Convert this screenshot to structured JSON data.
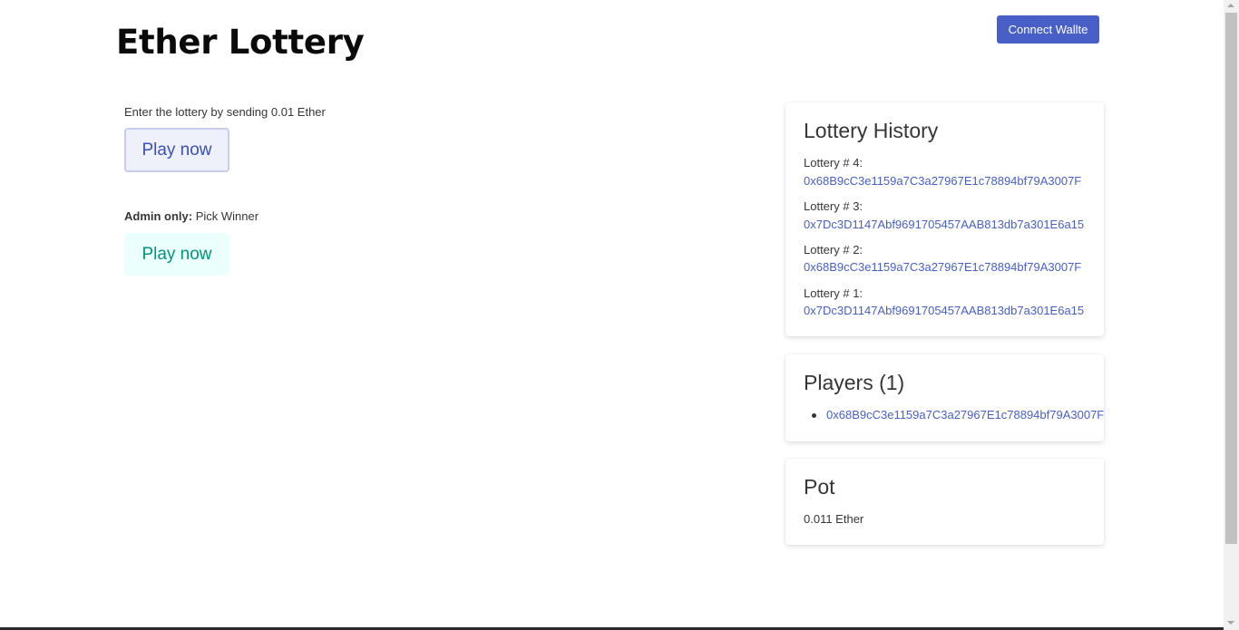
{
  "header": {
    "title": "Ether Lottery",
    "connect_label": "Connect Wallte"
  },
  "main": {
    "enter_text": "Enter the lottery by sending 0.01 Ether",
    "play_label": "Play now",
    "admin_bold": "Admin only:",
    "admin_text": " Pick Winner",
    "winner_label": "Play now"
  },
  "history": {
    "title": "Lottery History",
    "entries": [
      {
        "label": "Lottery # 4:",
        "address": "0x68B9cC3e1159a7C3a27967E1c78894bf79A3007F"
      },
      {
        "label": "Lottery # 3:",
        "address": "0x7Dc3D1147Abf9691705457AAB813db7a301E6a15"
      },
      {
        "label": "Lottery # 2:",
        "address": "0x68B9cC3e1159a7C3a27967E1c78894bf79A3007F"
      },
      {
        "label": "Lottery # 1:",
        "address": "0x7Dc3D1147Abf9691705457AAB813db7a301E6a15"
      }
    ]
  },
  "players": {
    "title": "Players (1)",
    "items": [
      "0x68B9cC3e1159a7C3a27967E1c78894bf79A3007F"
    ]
  },
  "pot": {
    "title": "Pot",
    "value": "0.011 Ether"
  },
  "colors": {
    "primary": "#485fc7",
    "link": "#485fc7",
    "success": "#00947e"
  }
}
